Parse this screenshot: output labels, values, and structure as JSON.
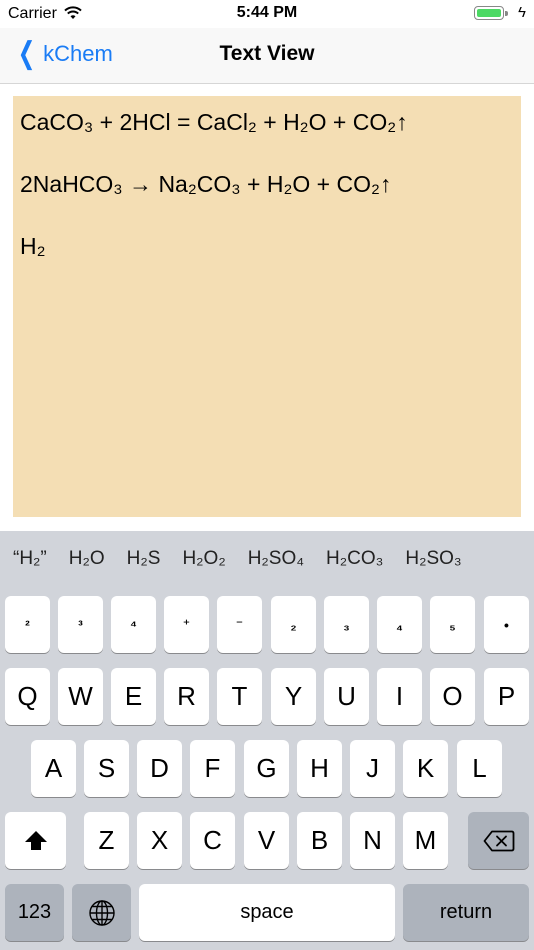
{
  "status_bar": {
    "carrier": "Carrier",
    "time": "5:44 PM"
  },
  "nav": {
    "back_label": "kChem",
    "title": "Text View"
  },
  "text_view": {
    "lines": [
      "CaCO₃ + 2HCl = CaCl₂ + H₂O + CO₂↑",
      "2NaHCO₃ → Na₂CO₃ + H₂O + CO₂↑",
      "H₂"
    ]
  },
  "keyboard": {
    "suggestions": [
      "“H₂”",
      "H₂O",
      "H₂S",
      "H₂O₂",
      "H₂SO₄",
      "H₂CO₃",
      "H₂SO₃"
    ],
    "row_symbols": [
      "²",
      "³",
      "⁴",
      "⁺",
      "⁻",
      "₂",
      "₃",
      "₄",
      "₅",
      "•"
    ],
    "row1": [
      "Q",
      "W",
      "E",
      "R",
      "T",
      "Y",
      "U",
      "I",
      "O",
      "P"
    ],
    "row2": [
      "A",
      "S",
      "D",
      "F",
      "G",
      "H",
      "J",
      "K",
      "L"
    ],
    "row3": [
      "Z",
      "X",
      "C",
      "V",
      "B",
      "N",
      "M"
    ],
    "numbers_key": "123",
    "space_key": "space",
    "return_key": "return"
  }
}
